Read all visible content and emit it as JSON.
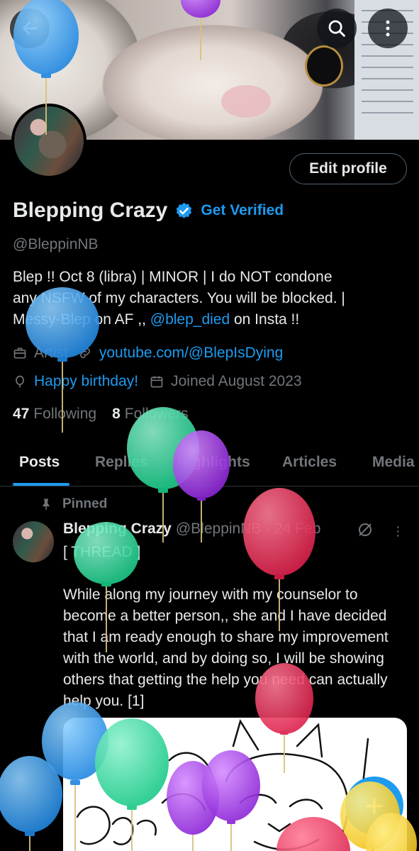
{
  "header": {
    "back_icon": "arrow-left-icon",
    "search_icon": "search-icon",
    "more_icon": "more-vertical-icon"
  },
  "profile": {
    "edit_label": "Edit profile",
    "name": "Blepping Crazy",
    "get_verified": "Get Verified",
    "handle": "@BleppinNB",
    "bio_line1": "Blep !! Oct 8 (libra) | MINOR | I do NOT condone",
    "bio_line2": "any NSFW of my characters. You will be blocked. |",
    "bio_line3_a": "Messy-Blep on AF ,, ",
    "bio_line3_link": "@blep_died",
    "bio_line3_b": " on Insta !!",
    "category": "Artist",
    "website": "youtube.com/@BlepIsDying",
    "birthday": "Happy birthday!",
    "joined": "Joined August 2023",
    "following_count": "47",
    "following_label": "Following",
    "followers_count": "8",
    "followers_label": "Followers"
  },
  "tabs": [
    "Posts",
    "Replies",
    "Highlights",
    "Articles",
    "Media"
  ],
  "post": {
    "pinned_label": "Pinned",
    "author": "Blepping Crazy",
    "meta": "@BleppinNB · 24 Feb",
    "text": "[ THREAD ]\n\nWhile along my journey with my counselor to become a better person,, she and I have decided that I am ready enough to share my improvement with the world, and by doing so, I will be showing others that getting the help you need can actually help you. [1]"
  },
  "fab_label": "+",
  "colors": {
    "accent": "#1d9bf0",
    "muted": "#71767b",
    "text": "#e7e9ea",
    "background": "#000000"
  }
}
